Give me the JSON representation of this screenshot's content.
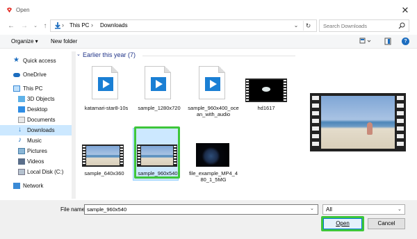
{
  "window": {
    "title": "Open",
    "close_glyph": "✕"
  },
  "address": {
    "crumbs": [
      "This PC",
      "Downloads"
    ],
    "separator": "›"
  },
  "search": {
    "placeholder": "Search Downloads"
  },
  "toolbar": {
    "organize": "Organize ▾",
    "new_folder": "New folder",
    "help": "?"
  },
  "nav": {
    "items": [
      {
        "label": "Quick access",
        "icon": "star-icon"
      },
      {
        "label": "OneDrive",
        "icon": "cloud-icon"
      },
      {
        "label": "This PC",
        "icon": "computer-icon"
      },
      {
        "label": "3D Objects",
        "icon": "cube-icon"
      },
      {
        "label": "Desktop",
        "icon": "desktop-icon"
      },
      {
        "label": "Documents",
        "icon": "documents-icon"
      },
      {
        "label": "Downloads",
        "icon": "download-icon",
        "selected": true
      },
      {
        "label": "Music",
        "icon": "music-icon"
      },
      {
        "label": "Pictures",
        "icon": "pictures-icon"
      },
      {
        "label": "Videos",
        "icon": "videos-icon"
      },
      {
        "label": "Local Disk (C:)",
        "icon": "disk-icon"
      },
      {
        "label": "Network",
        "icon": "network-icon"
      }
    ]
  },
  "content": {
    "group_chevron": "⌄",
    "group_label": "Earlier this year (7)",
    "files": [
      {
        "name": "katamari-star8-10s",
        "kind": "video-doc"
      },
      {
        "name": "sample_1280x720",
        "kind": "video-doc"
      },
      {
        "name": "sample_960x400_ocean_with_audio",
        "kind": "video-doc"
      },
      {
        "name": "hd1617",
        "kind": "film-night"
      },
      {
        "name": "sample_640x360",
        "kind": "film-beach"
      },
      {
        "name": "sample_960x540",
        "kind": "film-beach",
        "selected": true
      },
      {
        "name": "file_example_MP4_480_1_5MG",
        "kind": "film-earth"
      }
    ]
  },
  "footer": {
    "file_name_label": "File name:",
    "file_name_value": "sample_960x540",
    "file_type": "All",
    "open_label": "Open",
    "cancel_label": "Cancel"
  },
  "colors": {
    "highlight": "#3ec63a",
    "selection": "#cce8ff",
    "accent": "#0078d7"
  }
}
